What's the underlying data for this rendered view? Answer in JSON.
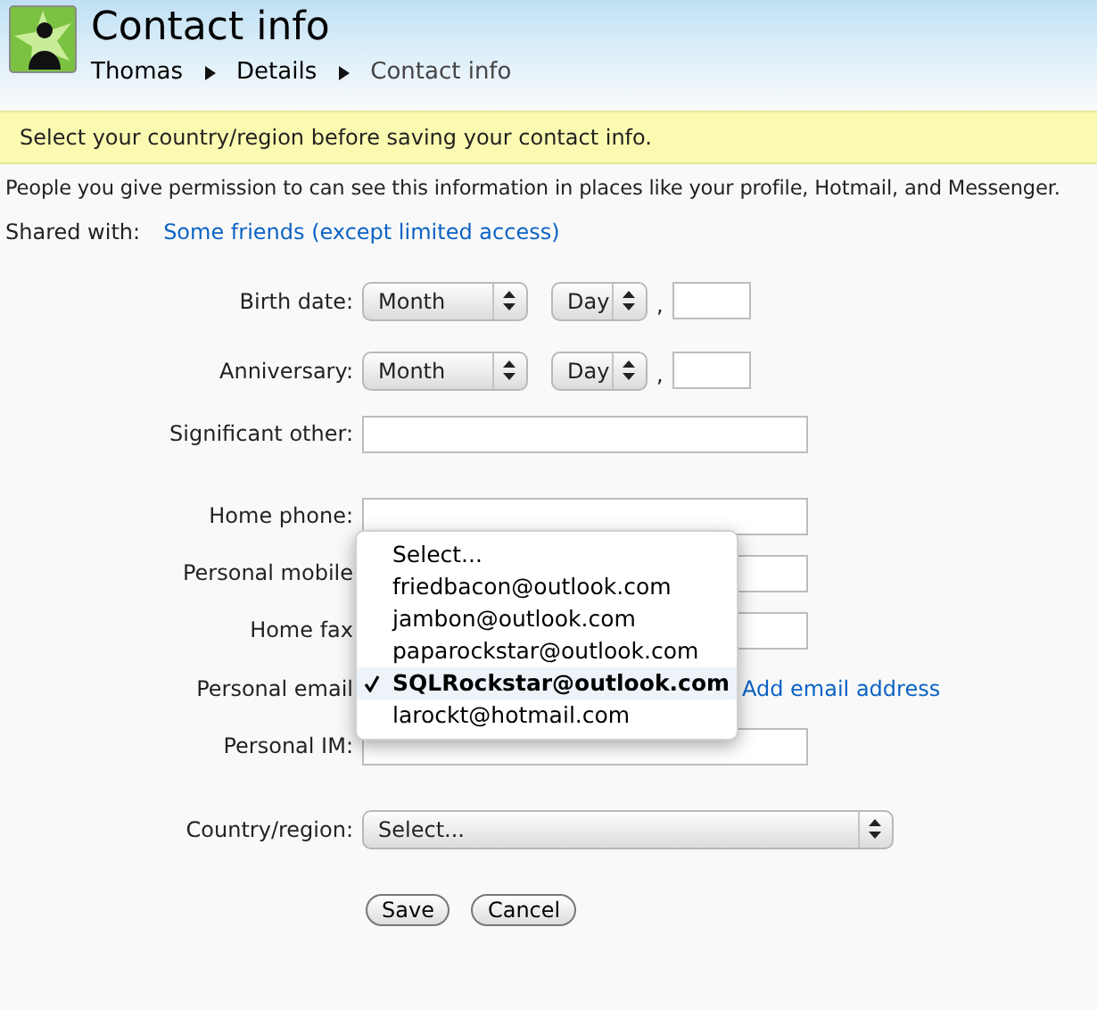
{
  "header": {
    "title": "Contact info",
    "breadcrumb": [
      {
        "label": "Thomas",
        "selected": false
      },
      {
        "label": "Details",
        "selected": false
      },
      {
        "label": "Contact info",
        "selected": true
      }
    ]
  },
  "notice": "Select your country/region before saving your contact info.",
  "description": "People you give permission to can see this information in places like your profile, Hotmail, and Messenger.",
  "shared_with": {
    "label": "Shared with:",
    "value": "Some friends (except limited access)"
  },
  "fields": [
    {
      "kind": "date",
      "label": "Birth date:",
      "month": "Month",
      "day": "Day",
      "separator": ","
    },
    {
      "kind": "date",
      "label": "Anniversary:",
      "month": "Month",
      "day": "Day",
      "separator": ","
    },
    {
      "kind": "text",
      "label": "Significant other:"
    },
    {
      "kind": "text",
      "label": "Home phone:"
    },
    {
      "kind": "text",
      "label": "Personal mobile"
    },
    {
      "kind": "text",
      "label": "Home fax"
    },
    {
      "kind": "email",
      "label": "Personal email",
      "link": "Add email address",
      "expanded": true,
      "options": [
        {
          "label": "Select...",
          "selected": false
        },
        {
          "label": "friedbacon@outlook.com",
          "selected": false
        },
        {
          "label": "jambon@outlook.com",
          "selected": false
        },
        {
          "label": "paparockstar@outlook.com",
          "selected": false
        },
        {
          "label": "SQLRockstar@outlook.com",
          "selected": true
        },
        {
          "label": "larockt@hotmail.com",
          "selected": false
        }
      ]
    },
    {
      "kind": "text",
      "label": "Personal IM:"
    },
    {
      "kind": "select",
      "label": "Country/region:",
      "value": "Select..."
    }
  ],
  "buttons": [
    "Save",
    "Cancel"
  ]
}
